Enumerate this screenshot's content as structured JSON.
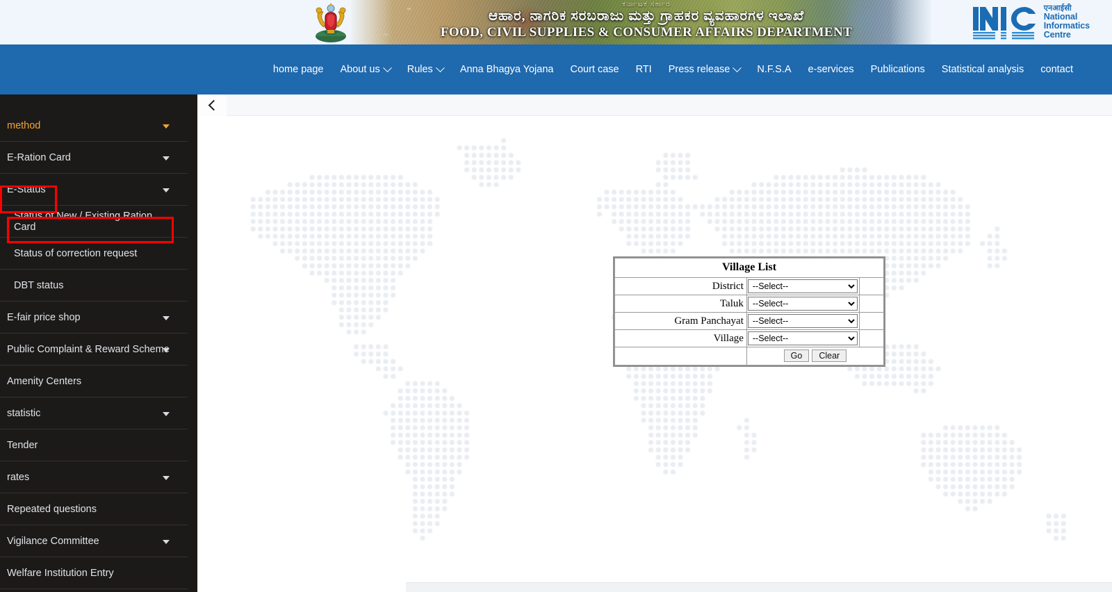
{
  "header": {
    "emblem_alt": "karnataka-state-emblem",
    "banner_kannada_sub": "ಕರ್ನಾಟಕ ಸರ್ಕಾರ",
    "banner_kannada_main": "ಆಹಾರ, ನಾಗರಿಕ ಸರಬರಾಜು ಮತ್ತು ಗ್ರಾಹಕರ ವ್ಯವಹಾರಗಳ ಇಲಾಖೆ",
    "banner_english": "FOOD, CIVIL SUPPLIES & CONSUMER AFFAIRS DEPARTMENT",
    "nic": {
      "mark": "NIC",
      "hindi": "एनआईसी",
      "line1": "National",
      "line2": "Informatics",
      "line3": "Centre"
    },
    "colors": {
      "header_bg": "#f0f6fc",
      "nic_blue": "#1b6cb3"
    }
  },
  "nav": {
    "bg_color": "#1f69ae",
    "items": [
      {
        "label": "home page",
        "has_dropdown": false
      },
      {
        "label": "About us",
        "has_dropdown": true
      },
      {
        "label": "Rules",
        "has_dropdown": true
      },
      {
        "label": "Anna Bhagya Yojana",
        "has_dropdown": false
      },
      {
        "label": "Court case",
        "has_dropdown": false
      },
      {
        "label": "RTI",
        "has_dropdown": false
      },
      {
        "label": "Press release",
        "has_dropdown": true
      },
      {
        "label": "N.F.S.A",
        "has_dropdown": false
      },
      {
        "label": "e-services",
        "has_dropdown": false
      },
      {
        "label": "Publications",
        "has_dropdown": false
      },
      {
        "label": "Statistical analysis",
        "has_dropdown": false
      },
      {
        "label": "contact",
        "has_dropdown": false
      }
    ]
  },
  "sidebar": {
    "bg_color": "#1c1a19",
    "accent_color": "#f0a62c",
    "highlight_color": "#ff0000",
    "items": [
      {
        "label": "method",
        "has_caret": true,
        "sub": false,
        "accent": true
      },
      {
        "label": "E-Ration Card",
        "has_caret": true,
        "sub": false,
        "accent": false
      },
      {
        "label": "E-Status",
        "has_caret": true,
        "sub": false,
        "accent": false,
        "highlighted": true
      },
      {
        "label": "Status of New / Existing Ration Card",
        "has_caret": false,
        "sub": true,
        "accent": false,
        "highlighted": true
      },
      {
        "label": "Status of correction request",
        "has_caret": false,
        "sub": true,
        "accent": false
      },
      {
        "label": "DBT status",
        "has_caret": false,
        "sub": true,
        "accent": false
      },
      {
        "label": "E-fair price shop",
        "has_caret": true,
        "sub": false,
        "accent": false
      },
      {
        "label": "Public Complaint & Reward Scheme",
        "has_caret": true,
        "sub": false,
        "accent": false
      },
      {
        "label": "Amenity Centers",
        "has_caret": false,
        "sub": false,
        "accent": false
      },
      {
        "label": "statistic",
        "has_caret": true,
        "sub": false,
        "accent": false
      },
      {
        "label": "Tender",
        "has_caret": false,
        "sub": false,
        "accent": false
      },
      {
        "label": "rates",
        "has_caret": true,
        "sub": false,
        "accent": false
      },
      {
        "label": "Repeated questions",
        "has_caret": false,
        "sub": false,
        "accent": false
      },
      {
        "label": "Vigilance Committee",
        "has_caret": true,
        "sub": false,
        "accent": false
      },
      {
        "label": "Welfare Institution Entry",
        "has_caret": false,
        "sub": false,
        "accent": false
      }
    ]
  },
  "content": {
    "back_icon": "chevron-left-icon",
    "background": "dotted-world-map"
  },
  "village_form": {
    "title": "Village List",
    "rows": [
      {
        "label": "District",
        "value": "--Select--"
      },
      {
        "label": "Taluk",
        "value": "--Select--"
      },
      {
        "label": "Gram Panchayat",
        "value": "--Select--"
      },
      {
        "label": "Village",
        "value": "--Select--"
      }
    ],
    "select_placeholder": "--Select--",
    "go_label": "Go",
    "clear_label": "Clear"
  }
}
